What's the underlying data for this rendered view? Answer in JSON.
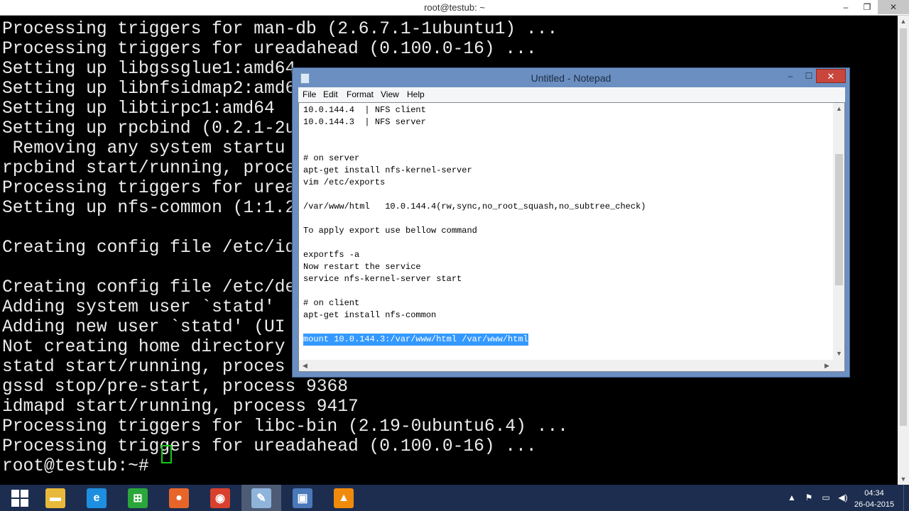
{
  "terminal": {
    "title": "root@testub: ~",
    "controls": {
      "minimize": "–",
      "maximize": "❐",
      "close": "✕"
    },
    "lines": [
      "Processing triggers for man-db (2.6.7.1-1ubuntu1) ...",
      "Processing triggers for ureadahead (0.100.0-16) ...",
      "Setting up libgssglue1:amd64",
      "Setting up libnfsidmap2:amd6",
      "Setting up libtirpc1:amd64",
      "Setting up rpcbind (0.2.1-2u",
      " Removing any system startu",
      "rpcbind start/running, proce",
      "Processing triggers for urea",
      "Setting up nfs-common (1:1.2",
      "",
      "Creating config file /etc/id",
      "",
      "Creating config file /etc/de",
      "Adding system user `statd'",
      "Adding new user `statd' (UI",
      "Not creating home directory",
      "statd start/running, proces",
      "gssd stop/pre-start, process 9368",
      "idmapd start/running, process 9417",
      "Processing triggers for libc-bin (2.19-0ubuntu6.4) ...",
      "Processing triggers for ureadahead (0.100.0-16) ...",
      "root@testub:~# "
    ]
  },
  "notepad": {
    "title": "Untitled - Notepad",
    "controls": {
      "minimize": "–",
      "maximize": "☐",
      "close": "✕"
    },
    "menu": [
      "File",
      "Edit",
      "Format",
      "View",
      "Help"
    ],
    "lines": [
      "10.0.144.4  | NFS client",
      "10.0.144.3  | NFS server",
      "",
      "",
      "# on server",
      "apt-get install nfs-kernel-server",
      "vim /etc/exports",
      "",
      "/var/www/html   10.0.144.4(rw,sync,no_root_squash,no_subtree_check)",
      "",
      "To apply export use bellow command",
      "",
      "exportfs -a",
      "Now restart the service",
      "service nfs-kernel-server start",
      "",
      "# on client",
      "apt-get install nfs-common",
      "",
      "mount 10.0.144.3:/var/www/html /var/www/html"
    ],
    "selected_line_index": 19
  },
  "taskbar": {
    "apps": [
      {
        "name": "file-explorer",
        "glyph": "▬",
        "color": "#e8b93a"
      },
      {
        "name": "internet-explorer",
        "glyph": "e",
        "color": "#1e8fe0"
      },
      {
        "name": "store",
        "glyph": "⊞",
        "color": "#2aa63a"
      },
      {
        "name": "firefox",
        "glyph": "●",
        "color": "#e8652a"
      },
      {
        "name": "chrome",
        "glyph": "◉",
        "color": "#d9412f"
      },
      {
        "name": "notepad",
        "glyph": "✎",
        "color": "#8fb4dc"
      },
      {
        "name": "remote-desktop",
        "glyph": "▣",
        "color": "#4a78b8"
      },
      {
        "name": "vlc",
        "glyph": "▲",
        "color": "#f08a0c"
      }
    ],
    "clock": {
      "time": "04:34",
      "date": "26-04-2015"
    },
    "tray": [
      "▲",
      "⚑",
      "▭",
      "◀)"
    ]
  }
}
